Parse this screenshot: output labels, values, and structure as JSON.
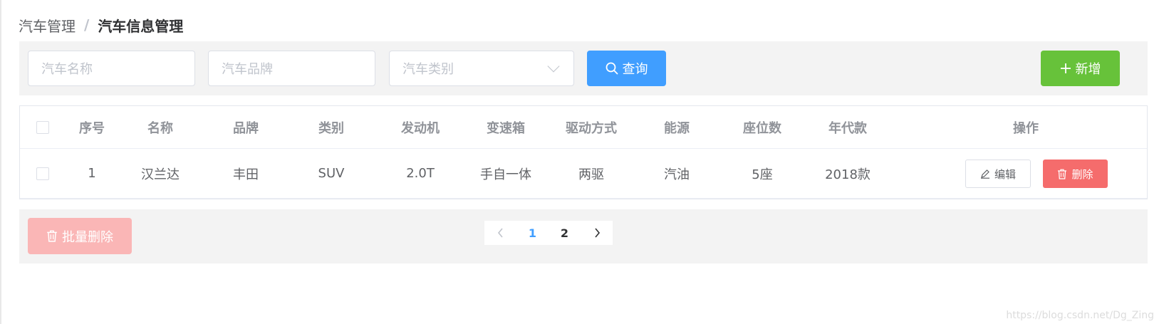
{
  "breadcrumb": {
    "parent": "汽车管理",
    "separator": "/",
    "current": "汽车信息管理"
  },
  "search": {
    "name_placeholder": "汽车名称",
    "brand_placeholder": "汽车品牌",
    "type_placeholder": "汽车类别",
    "query_label": "查询",
    "add_label": "新增"
  },
  "table": {
    "headers": [
      "序号",
      "名称",
      "品牌",
      "类别",
      "发动机",
      "变速箱",
      "驱动方式",
      "能源",
      "座位数",
      "年代款",
      "操作"
    ],
    "rows": [
      [
        "1",
        "汉兰达",
        "丰田",
        "SUV",
        "2.0T",
        "手自一体",
        "两驱",
        "汽油",
        "5座",
        "2018款"
      ]
    ],
    "edit_label": "编辑",
    "delete_label": "删除"
  },
  "footer": {
    "batch_delete_label": "批量删除",
    "pages": [
      "1",
      "2"
    ],
    "current_page": 1
  },
  "watermark": "https://blog.csdn.net/Dg_Zing",
  "colors": {
    "primary": "#409eff",
    "success": "#67c23a",
    "danger": "#f56c6c",
    "danger_light": "#fab6b6"
  }
}
